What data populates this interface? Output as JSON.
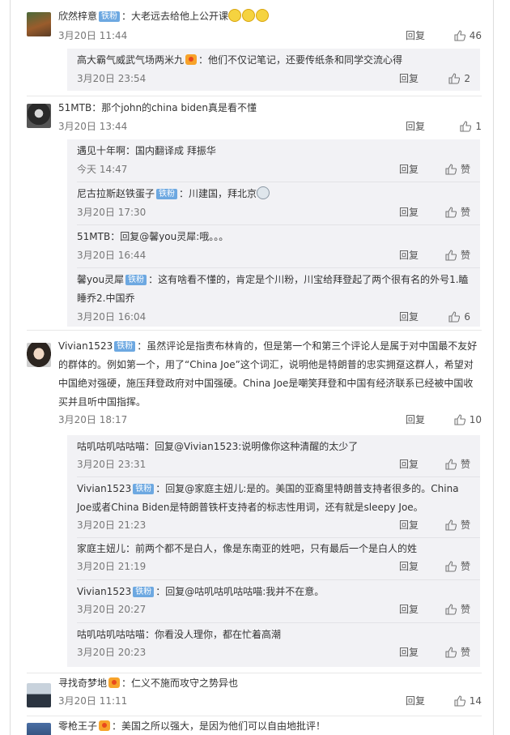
{
  "labels": {
    "reply": "回复",
    "like_label": "赞"
  },
  "comments": [
    {
      "user": "欣然梓意",
      "badge": "铁粉",
      "text": "：大老远去给他上公开课",
      "time": "3月20日 11:44",
      "likes": "46",
      "replies": [
        {
          "user": "高大霸气威武气场两米九",
          "text": "：他们不仅记笔记，还要传纸条和同学交流心得",
          "time": "3月20日 23:54",
          "likes": "2"
        }
      ]
    },
    {
      "user": "51MTB",
      "text": "：那个john的china biden真是看不懂",
      "time": "3月20日 13:44",
      "likes": "1",
      "replies": [
        {
          "user": "遇见十年啊",
          "text": "：国内翻译成 拜振华",
          "time": "今天 14:47",
          "likes": "赞"
        },
        {
          "user": "尼古拉斯赵铁蛋子",
          "badge": "铁粉",
          "text": "：川建国，拜北京",
          "time": "3月20日 17:30",
          "likes": "赞"
        },
        {
          "user": "51MTB",
          "text": "：回复@馨you灵犀:哦。。。",
          "time": "3月20日 16:44",
          "likes": "赞"
        },
        {
          "user": "馨you灵犀",
          "badge": "铁粉",
          "text": "：这有啥看不懂的，肯定是个川粉，川宝给拜登起了两个很有名的外号1.瞌睡乔2.中国乔",
          "time": "3月20日 16:04",
          "likes": "6"
        }
      ]
    },
    {
      "user": "Vivian1523",
      "badge": "铁粉",
      "text": "：虽然评论是指责布林肯的，但是第一个和第三个评论人是属于对中国最不友好的群体的。例如第一个，用了“China Joe”这个词汇，说明他是特朗普的忠实拥趸这群人，希望对中国绝对强硬，施压拜登政府对中国强硬。China Joe是嘲笑拜登和中国有经济联系已经被中国收买并且听中国指挥。",
      "time": "3月20日 18:17",
      "likes": "10",
      "replies": [
        {
          "user": "咕叽咕叽咕咕喵",
          "text": "：回复@Vivian1523:说明像你这种清醒的太少了",
          "time": "3月20日 23:31",
          "likes": "赞"
        },
        {
          "user": "Vivian1523",
          "badge": "铁粉",
          "text": "：回复@家庭主妞儿:是的。美国的亚裔里特朗普支持者很多的。China Joe或者China Biden是特朗普铁杆支持者的标志性用词，还有就是sleepy Joe。",
          "time": "3月20日 21:23",
          "likes": "赞"
        },
        {
          "user": "家庭主妞儿",
          "text": "：前两个都不是白人，像是东南亚的姓吧，只有最后一个是白人的姓",
          "time": "3月20日 21:19",
          "likes": "赞"
        },
        {
          "user": "Vivian1523",
          "badge": "铁粉",
          "text": "：回复@咕叽咕叽咕咕喵:我并不在意。",
          "time": "3月20日 20:27",
          "likes": "赞"
        },
        {
          "user": "咕叽咕叽咕咕喵",
          "text": "：你看没人理你，都在忙着高潮",
          "time": "3月20日 20:23",
          "likes": "赞"
        }
      ]
    },
    {
      "user": "寻找奇梦地",
      "text": "：仁义不施而攻守之势异也",
      "time": "3月20日 11:11",
      "likes": "14",
      "replies": []
    },
    {
      "user": "零枪王子",
      "text": "：美国之所以强大，是因为他们可以自由地批评！",
      "time": "",
      "likes": "",
      "replies": []
    }
  ]
}
